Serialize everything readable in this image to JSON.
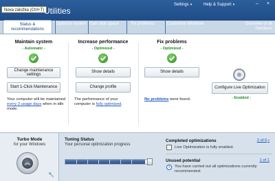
{
  "window": {
    "tooltip": "Nova záložka (Ctrl+T)",
    "app_title": "Utilities",
    "settings_label": "Settings",
    "help_label": "Help & Support",
    "minimize": "–",
    "close": "×"
  },
  "tabs": [
    {
      "label": "Status & recommendations"
    },
    {
      "label": "Optimize system"
    },
    {
      "label": "Gain disk space"
    },
    {
      "label": "Fix problems"
    },
    {
      "label": "Customize Windows"
    }
  ],
  "overview_label": "Overview of all functions",
  "maintain": {
    "title": "Maintain system",
    "status": "- Automatic -",
    "btn_change": "Change maintenance settings",
    "btn_start": "Start 1-Click Maintenance",
    "desc_before": "Your computer will be maintained ",
    "desc_link": "every 3 usage days",
    "desc_after": " when in idle mode."
  },
  "performance": {
    "title": "Increase performance",
    "status": "- Optimized -",
    "btn_details": "Show details",
    "btn_profile": "Change profile",
    "desc_before": "The performance of your computer is ",
    "desc_link": "fully optimized",
    "desc_after": "."
  },
  "fix": {
    "title": "Fix problems",
    "status": "- Optimized -",
    "btn_details": "Show details",
    "desc_link": "No problems",
    "desc_after": " were found."
  },
  "live": {
    "btn_configure": "Configure Live Optimization",
    "status": "- Enabled -"
  },
  "turbo": {
    "title": "Turbo Mode",
    "sub": "for your Windows"
  },
  "tuning": {
    "title": "Tuning Status",
    "sub": "Your personal optimization progress",
    "progress": 0.92
  },
  "completed": {
    "title": "Completed optimizations",
    "count": "2 of 6",
    "text": "Live Optimization is fully enabled."
  },
  "unused": {
    "title": "Unused potential",
    "count": "1 of 1",
    "text": "You have carried out all optimizations currently recommended."
  }
}
